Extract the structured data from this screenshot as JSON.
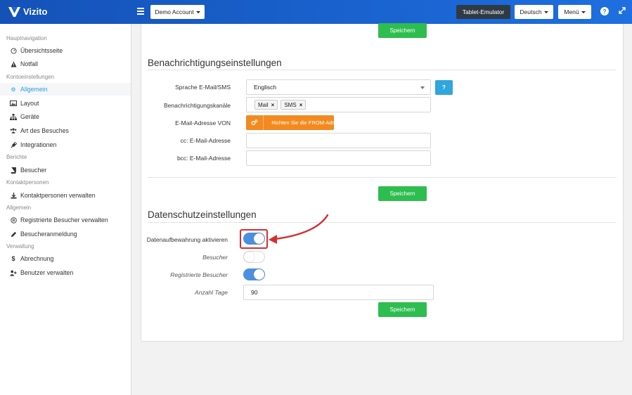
{
  "app": {
    "name": "Vizito"
  },
  "topbar": {
    "account_label": "Demo Account",
    "tablet_label": "Tablet-Emulator",
    "language_label": "Deutsch",
    "menu_label": "Menü",
    "help_label": "?",
    "expand_icon": "expand-icon"
  },
  "sidebar": {
    "sections": [
      {
        "title": "Hauptnavigation",
        "items": [
          {
            "label": "Übersichtsseite",
            "icon": "dashboard-icon"
          },
          {
            "label": "Notfall",
            "icon": "warning-icon"
          }
        ]
      },
      {
        "title": "Kontoeinstellungen",
        "items": [
          {
            "label": "Allgemein",
            "icon": "gear-icon",
            "active": true
          },
          {
            "label": "Layout",
            "icon": "image-icon"
          },
          {
            "label": "Geräte",
            "icon": "sitemap-icon"
          },
          {
            "label": "Art des Besuches",
            "icon": "users-icon"
          },
          {
            "label": "Integrationen",
            "icon": "plug-icon"
          }
        ]
      },
      {
        "title": "Berichte",
        "items": [
          {
            "label": "Besucher",
            "icon": "book-icon"
          }
        ]
      },
      {
        "title": "Kontaktpersonen",
        "items": [
          {
            "label": "Kontaktpersonen verwalten",
            "icon": "download-icon"
          }
        ]
      },
      {
        "title": "Allgemein",
        "items": [
          {
            "label": "Registrierte Besucher verwalten",
            "icon": "registered-icon"
          },
          {
            "label": "Besucheranmeldung",
            "icon": "pencil-icon"
          }
        ]
      },
      {
        "title": "Verwaltung",
        "items": [
          {
            "label": "Abrechnung",
            "icon": "dollar-icon"
          },
          {
            "label": "Benutzer verwalten",
            "icon": "user-plus-icon"
          }
        ]
      }
    ]
  },
  "main": {
    "save_label": "Speichern",
    "notifications": {
      "title": "Benachrichtigungseinstellungen",
      "language_label": "Sprache E-Mail/SMS",
      "language_value": "Englisch",
      "help_button": "?",
      "channels_label": "Benachrichtigungskanäle",
      "channels": [
        "Mail",
        "SMS"
      ],
      "from_label": "E-Mail-Adresse VON",
      "from_button": "Richten Sie die FROM-Adr",
      "cc_label": "cc: E-Mail-Adresse",
      "cc_value": "",
      "bcc_label": "bcc: E-Mail-Adresse",
      "bcc_value": ""
    },
    "privacy": {
      "title": "Datenschutzeinstellungen",
      "retention_label": "Datenaufbewahrung aktivieren",
      "retention_on": true,
      "visitors_label": "Besucher",
      "visitors_on": false,
      "registered_label": "Registrierte Besucher",
      "registered_on": true,
      "days_label": "Anzahl Tage",
      "days_value": "90"
    }
  },
  "colors": {
    "topbar": "#1e6fe0",
    "save_button": "#2ebd4f",
    "toggle_on": "#4a8fe0",
    "highlight": "#d32f2f",
    "orange_button": "#f38a1f",
    "help_button": "#2fa6dc",
    "active_nav": "#2a9fd6"
  }
}
